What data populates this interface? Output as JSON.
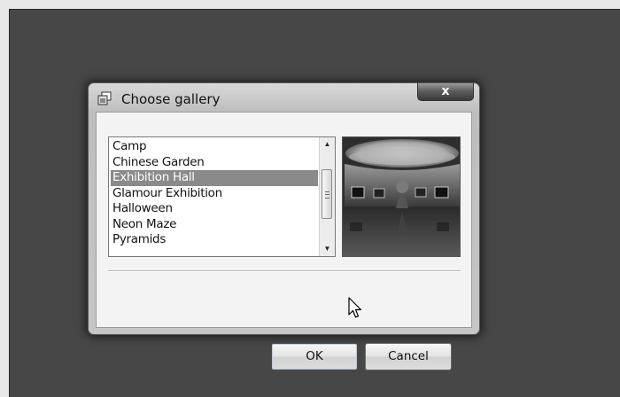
{
  "dialog": {
    "title": "Choose gallery",
    "close_label": "x",
    "title_icon": "gallery-window-icon"
  },
  "gallery_list": {
    "items": [
      "Camp",
      "Chinese Garden",
      "Exhibition Hall",
      "Glamour Exhibition",
      "Halloween",
      "Neon Maze",
      "Pyramids"
    ],
    "selected": "Exhibition Hall"
  },
  "buttons": {
    "ok_label": "OK",
    "cancel_label": "Cancel"
  },
  "icons": {
    "scroll_up": "scroll-up-arrow-icon",
    "scroll_down": "scroll-down-arrow-icon",
    "cursor": "mouse-pointer-icon"
  }
}
